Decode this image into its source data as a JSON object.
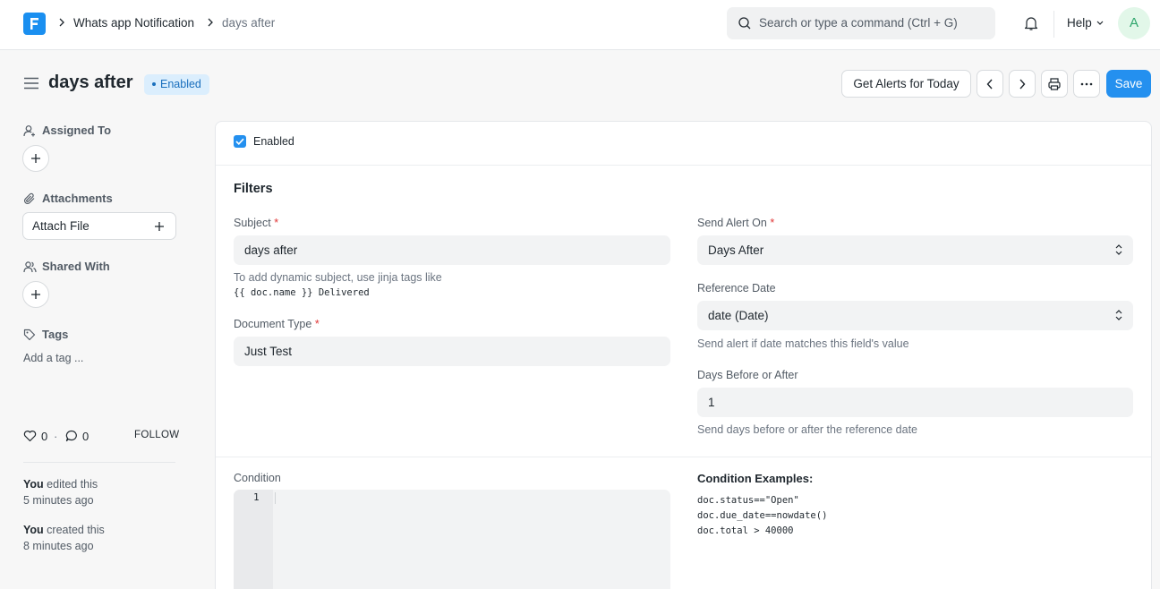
{
  "navbar": {
    "breadcrumbs": [
      "Whats app Notification",
      "days after"
    ],
    "search_placeholder": "Search or type a command (Ctrl + G)",
    "help_label": "Help",
    "avatar_initial": "A"
  },
  "header": {
    "title": "days after",
    "status": "Enabled",
    "get_alerts_label": "Get Alerts for Today",
    "save_label": "Save"
  },
  "sidebar": {
    "assigned_to": "Assigned To",
    "attachments": "Attachments",
    "attach_file": "Attach File",
    "shared_with": "Shared With",
    "tags": "Tags",
    "add_tag": "Add a tag ...",
    "likes": "0",
    "comments": "0",
    "follow": "FOLLOW",
    "activity": [
      {
        "user": "You",
        "action": " edited this",
        "time": "5 minutes ago"
      },
      {
        "user": "You",
        "action": " created this",
        "time": "8 minutes ago"
      }
    ]
  },
  "form": {
    "enabled_label": "Enabled",
    "enabled_checked": true,
    "section_title": "Filters",
    "subject": {
      "label": "Subject",
      "value": "days after",
      "desc": "To add dynamic subject, use jinja tags like",
      "desc_code": "{{ doc.name }} Delivered"
    },
    "document_type": {
      "label": "Document Type",
      "value": "Just Test"
    },
    "send_alert_on": {
      "label": "Send Alert On",
      "value": "Days After"
    },
    "reference_date": {
      "label": "Reference Date",
      "value": "date (Date)",
      "desc": "Send alert if date matches this field's value"
    },
    "days_before_after": {
      "label": "Days Before or After",
      "value": "1",
      "desc": "Send days before or after the reference date"
    },
    "condition": {
      "label": "Condition",
      "line_number": "1"
    },
    "condition_examples": {
      "title": "Condition Examples:",
      "lines": [
        "doc.status==\"Open\"",
        "doc.due_date==nowdate()",
        "doc.total > 40000"
      ]
    }
  },
  "colors": {
    "primary": "#2490ef",
    "badge_bg": "#dbeefd",
    "badge_text": "#1a6fbd",
    "required": "#e03636"
  }
}
